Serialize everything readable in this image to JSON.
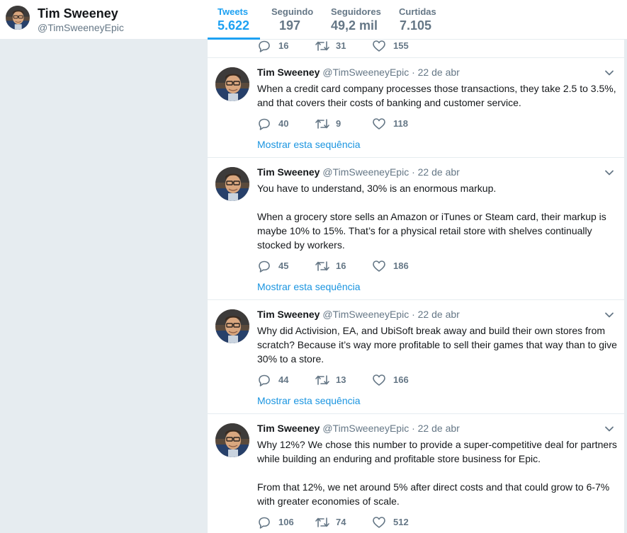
{
  "profile": {
    "name": "Tim Sweeney",
    "handle": "@TimSweeneyEpic"
  },
  "stats": [
    {
      "label": "Tweets",
      "value": "5.622"
    },
    {
      "label": "Seguindo",
      "value": "197"
    },
    {
      "label": "Seguidores",
      "value": "49,2 mil"
    },
    {
      "label": "Curtidas",
      "value": "7.105"
    }
  ],
  "colors": {
    "accent": "#1da1f2",
    "link": "#1b95e0",
    "muted": "#657786",
    "background": "#e6ecf0"
  },
  "top_tweet_actions": {
    "replies": "16",
    "retweets": "31",
    "likes": "155"
  },
  "show_thread_label": "Mostrar esta sequência",
  "tweets": [
    {
      "name": "Tim Sweeney",
      "handle": "@TimSweeneyEpic",
      "sep": "·",
      "date": "22 de abr",
      "paragraphs": [
        "When a credit card company processes those transactions, they take 2.5 to 3.5%, and that covers their costs of banking and customer service."
      ],
      "replies": "40",
      "retweets": "9",
      "likes": "118"
    },
    {
      "name": "Tim Sweeney",
      "handle": "@TimSweeneyEpic",
      "sep": "·",
      "date": "22 de abr",
      "paragraphs": [
        "You have to understand, 30% is an enormous markup.",
        "When a grocery store sells an Amazon or iTunes or Steam card, their markup is maybe 10% to 15%. That’s for a physical retail store with shelves continually stocked by workers."
      ],
      "replies": "45",
      "retweets": "16",
      "likes": "186"
    },
    {
      "name": "Tim Sweeney",
      "handle": "@TimSweeneyEpic",
      "sep": "·",
      "date": "22 de abr",
      "paragraphs": [
        "Why did Activision, EA, and UbiSoft break away and build their own stores from scratch? Because it’s way more profitable to sell their games that way than to give 30% to a store."
      ],
      "replies": "44",
      "retweets": "13",
      "likes": "166"
    },
    {
      "name": "Tim Sweeney",
      "handle": "@TimSweeneyEpic",
      "sep": "·",
      "date": "22 de abr",
      "paragraphs": [
        "Why 12%? We chose this number to provide a super-competitive deal for partners while building an enduring and profitable store business for Epic.",
        "From that 12%, we net around 5% after direct costs and that could grow to 6-7% with greater economies of scale."
      ],
      "replies": "106",
      "retweets": "74",
      "likes": "512"
    }
  ]
}
